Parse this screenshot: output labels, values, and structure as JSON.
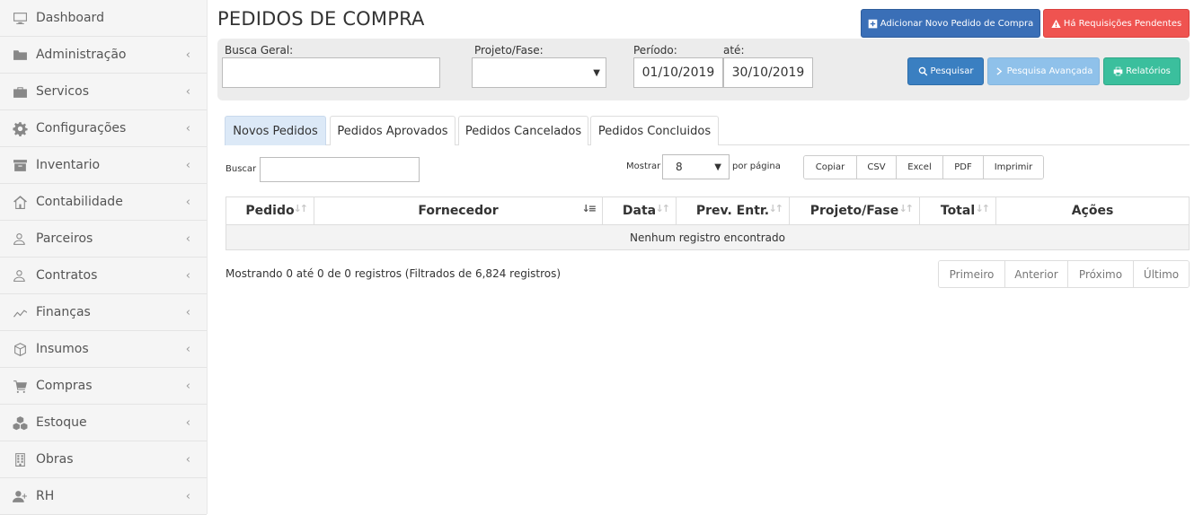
{
  "sidebar": {
    "items": [
      {
        "label": "Dashboard",
        "icon": "monitor-icon",
        "chevron": ""
      },
      {
        "label": "Administração",
        "icon": "folder-icon",
        "chevron": "‹"
      },
      {
        "label": "Servicos",
        "icon": "briefcase-icon",
        "chevron": "‹"
      },
      {
        "label": "Configurações",
        "icon": "gear-icon",
        "chevron": "‹"
      },
      {
        "label": "Inventario",
        "icon": "archive-icon",
        "chevron": "‹"
      },
      {
        "label": "Contabilidade",
        "icon": "home-icon",
        "chevron": "‹"
      },
      {
        "label": "Parceiros",
        "icon": "users-icon",
        "chevron": "‹"
      },
      {
        "label": "Contratos",
        "icon": "users-icon",
        "chevron": "‹"
      },
      {
        "label": "Finanças",
        "icon": "line-chart-icon",
        "chevron": "‹"
      },
      {
        "label": "Insumos",
        "icon": "cube-icon",
        "chevron": "‹"
      },
      {
        "label": "Compras",
        "icon": "cart-icon",
        "chevron": "‹"
      },
      {
        "label": "Estoque",
        "icon": "cubes-icon",
        "chevron": "‹"
      },
      {
        "label": "Obras",
        "icon": "building-icon",
        "chevron": "‹"
      },
      {
        "label": "RH",
        "icon": "user-plus-icon",
        "chevron": "‹"
      }
    ]
  },
  "header": {
    "title": "PEDIDOS DE COMPRA",
    "add_button": "Adicionar Novo Pedido de Compra",
    "pending_button": "Há Requisições Pendentes"
  },
  "filters": {
    "busca_label": "Busca Geral:",
    "busca_value": "",
    "projeto_label": "Projeto/Fase:",
    "projeto_value": "",
    "periodo_label": "Período:",
    "ate_label": "até:",
    "date_from": "01/10/2019",
    "date_to": "30/10/2019",
    "search_button": "Pesquisar",
    "advanced_button": "Pesquisa Avançada",
    "reports_button": "Relatórios"
  },
  "tabs": [
    {
      "label": "Novos Pedidos",
      "active": true
    },
    {
      "label": "Pedidos Aprovados",
      "active": false
    },
    {
      "label": "Pedidos Cancelados",
      "active": false
    },
    {
      "label": "Pedidos Concluidos",
      "active": false
    }
  ],
  "table_tools": {
    "search_label": "Buscar",
    "search_value": "",
    "show_label": "Mostrar",
    "show_value": "8",
    "per_page_label": "por página",
    "exports": [
      "Copiar",
      "CSV",
      "Excel",
      "PDF",
      "Imprimir"
    ]
  },
  "table": {
    "columns": [
      "Pedido",
      "Fornecedor",
      "Data",
      "Prev. Entr.",
      "Projeto/Fase",
      "Total",
      "Ações"
    ],
    "empty_message": "Nenhum registro encontrado"
  },
  "footer": {
    "info": "Mostrando 0 até 0 de 0 registros (Filtrados de 6,824 registros)",
    "pager": [
      "Primeiro",
      "Anterior",
      "Próximo",
      "Último"
    ]
  },
  "colors": {
    "primary": "#3a6fb7",
    "danger": "#ef5350",
    "info": "#3a7fc1",
    "info_light": "#8fc1ea",
    "success": "#3bbf9d"
  }
}
